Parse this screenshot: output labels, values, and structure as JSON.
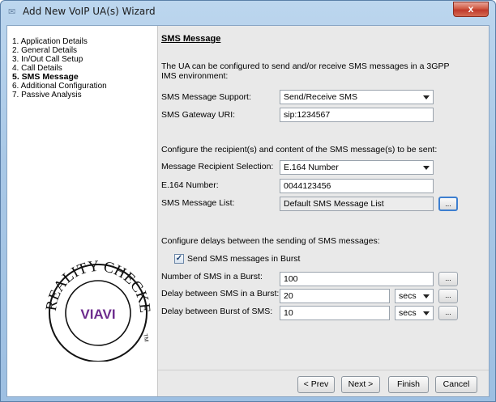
{
  "window": {
    "title": "Add New VoIP UA(s) Wizard",
    "close_label": "x"
  },
  "nav": {
    "items": [
      {
        "label": "1. Application Details"
      },
      {
        "label": "2. General Details"
      },
      {
        "label": "3. In/Out Call Setup"
      },
      {
        "label": "4. Call Details"
      },
      {
        "label": "5. SMS Message"
      },
      {
        "label": "6. Additional Configuration"
      },
      {
        "label": "7. Passive Analysis"
      }
    ],
    "active_index": 4
  },
  "logo": {
    "arc_text": "REALITY CHECKED",
    "brand": "VIAVI",
    "tm": "TM"
  },
  "content": {
    "section_title": "SMS Message",
    "intro_line1": "The UA can be configured to send and/or receive SMS messages in a 3GPP",
    "intro_line2": "IMS environment:",
    "sms_support_label": "SMS Message Support:",
    "sms_support_value": "Send/Receive SMS",
    "gateway_label": "SMS Gateway URI:",
    "gateway_value": "sip:1234567",
    "recipient_intro": "Configure the recipient(s) and content of the SMS message(s) to be sent:",
    "recipient_sel_label": "Message Recipient Selection:",
    "recipient_sel_value": "E.164 Number",
    "e164_label": "E.164 Number:",
    "e164_value": "0044123456",
    "msg_list_label": "SMS Message List:",
    "msg_list_value": "Default SMS Message List",
    "dots": "...",
    "delay_intro": "Configure delays between the sending of SMS messages:",
    "burst_checkbox_label": "Send SMS messages in Burst",
    "burst_checked": true,
    "num_burst_label": "Number of SMS in a Burst:",
    "num_burst_value": "100",
    "delay_sms_label": "Delay between SMS in a Burst:",
    "delay_sms_value": "20",
    "delay_sms_unit": "secs",
    "delay_burst_label": "Delay between Burst of SMS:",
    "delay_burst_value": "10",
    "delay_burst_unit": "secs"
  },
  "footer": {
    "prev": "< Prev",
    "next": "Next >",
    "finish": "Finish",
    "cancel": "Cancel"
  }
}
